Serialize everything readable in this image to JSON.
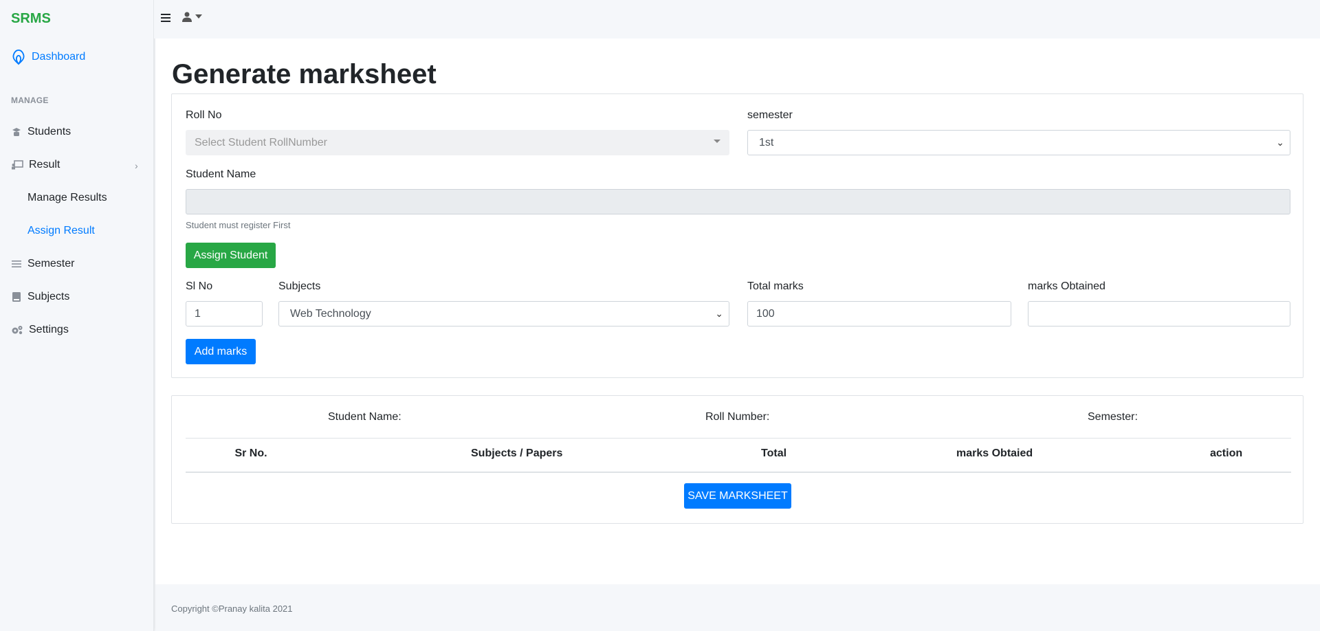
{
  "brand": "SRMS",
  "sidebar": {
    "dashboard": "Dashboard",
    "heading": "MANAGE",
    "items": [
      {
        "label": "Students"
      },
      {
        "label": "Result"
      },
      {
        "label": "Manage Results"
      },
      {
        "label": "Assign Result"
      },
      {
        "label": "Semester"
      },
      {
        "label": "Subjects"
      },
      {
        "label": "Settings"
      }
    ]
  },
  "page": {
    "title": "Generate marksheet"
  },
  "form": {
    "roll_label": "Roll No",
    "roll_placeholder": "Select Student RollNumber",
    "semester_label": "semester",
    "semester_value": "1st",
    "name_label": "Student Name",
    "name_value": "",
    "help_text": "Student must register First",
    "assign_button": "Assign Student",
    "slno_label": "Sl No",
    "slno_value": "1",
    "subjects_label": "Subjects",
    "subjects_value": "Web Technology",
    "total_label": "Total marks",
    "total_value": "100",
    "obtained_label": "marks Obtained",
    "obtained_value": "",
    "add_button": "Add marks"
  },
  "marksheet": {
    "student_name_label": "Student Name:",
    "roll_number_label": "Roll Number:",
    "semester_label": "Semester:",
    "columns": [
      "Sr No.",
      "Subjects / Papers",
      "Total",
      "marks Obtaied",
      "action"
    ],
    "save_button": "SAVE MARKSHEET"
  },
  "footer": {
    "copyright": "Copyright ©Pranay kalita 2021"
  },
  "colors": {
    "brand": "#28a745",
    "primary": "#007bff",
    "success": "#28a745"
  }
}
